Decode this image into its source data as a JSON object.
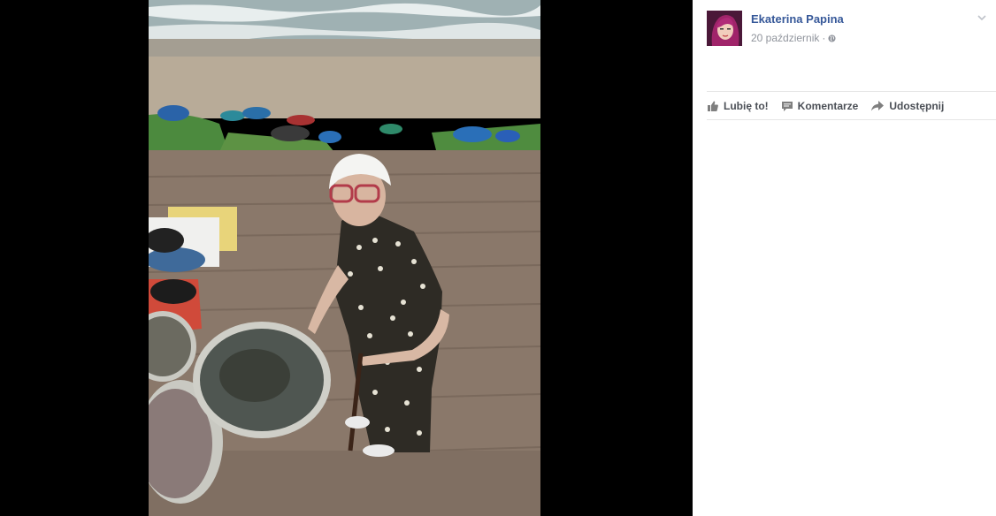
{
  "post": {
    "author": "Ekaterina Papina",
    "date": "20 październik",
    "separator": "·",
    "audience_icon": "globe-icon"
  },
  "actions": {
    "like": "Lubię to!",
    "comment": "Komentarze",
    "share": "Udostępnij"
  },
  "icons": {
    "like": "thumbs-up-icon",
    "comment": "comment-bubble-icon",
    "share": "share-arrow-icon",
    "options": "chevron-down-icon"
  },
  "colors": {
    "author": "#365899",
    "meta": "#90949c",
    "action_text": "#4b4f56",
    "backdrop": "#000000",
    "panel": "#ffffff"
  }
}
